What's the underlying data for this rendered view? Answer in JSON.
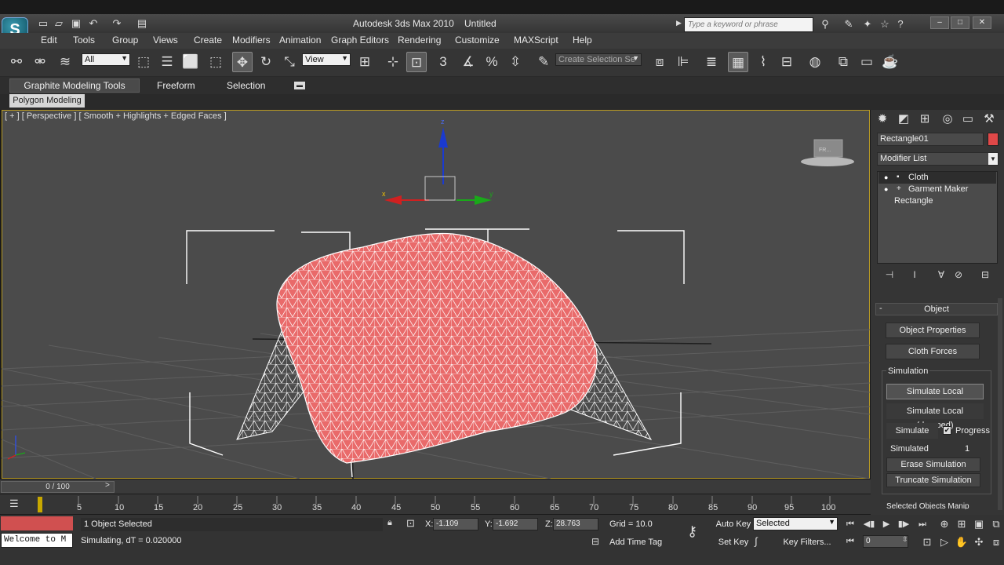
{
  "app": {
    "logo": "S",
    "title": "Autodesk 3ds Max 2010",
    "document": "Untitled",
    "search_placeholder": "Type a keyword or phrase",
    "window_buttons": [
      "–",
      "□",
      "✕"
    ]
  },
  "quick_access": [
    "new-icon",
    "open-icon",
    "save-icon",
    "undo-icon",
    "redo-icon",
    "project-icon"
  ],
  "menu": [
    "Edit",
    "Tools",
    "Group",
    "Views",
    "Create",
    "Modifiers",
    "Animation",
    "Graph Editors",
    "Rendering",
    "Customize",
    "MAXScript",
    "Help"
  ],
  "toolbar": {
    "selection_filter": "All",
    "ref_coord": "View",
    "named_selection": "Create Selection Se"
  },
  "ribbon": {
    "tabs": [
      "Graphite Modeling Tools",
      "Freeform",
      "Selection"
    ],
    "panel": "Polygon Modeling"
  },
  "viewport": {
    "label": "[ + ] [ Perspective ] [ Smooth + Highlights + Edged Faces ]",
    "gizmo_axes": {
      "x": "x",
      "y": "y",
      "z": "z"
    },
    "cloth_color": "#e96a6a",
    "viewcube_text": "FR..."
  },
  "command_panel": {
    "object_name": "Rectangle01",
    "object_color": "#e04848",
    "modifier_list": "Modifier List",
    "stack": [
      {
        "label": "Cloth",
        "active": true
      },
      {
        "label": "Garment Maker",
        "active": false
      },
      {
        "label": "Rectangle",
        "active": false
      }
    ],
    "rollout_title": "Object",
    "buttons": {
      "object_properties": "Object Properties",
      "cloth_forces": "Cloth Forces",
      "simulate_local": "Simulate Local",
      "simulate_local_damped": "Simulate Local (damped)",
      "simulate": "Simulate",
      "erase": "Erase Simulation",
      "truncate": "Truncate Simulation"
    },
    "simulation_group": "Simulation",
    "progress_label": "Progress",
    "progress_checked": true,
    "simulated_label": "Simulated",
    "simulated_value": "1",
    "next_rollout": "Selected Objects Manip"
  },
  "timeline": {
    "slider": "0 / 100",
    "ticks": [
      "5",
      "10",
      "15",
      "20",
      "25",
      "30",
      "35",
      "40",
      "45",
      "50",
      "55",
      "60",
      "65",
      "70",
      "75",
      "80",
      "85",
      "90",
      "95",
      "100"
    ]
  },
  "status": {
    "welcome": "Welcome to M",
    "selected": "1 Object Selected",
    "prompt": "Simulating, dT = 0.020000",
    "x_label": "X:",
    "x": "-1.109",
    "y_label": "Y:",
    "y": "-1.692",
    "z_label": "Z:",
    "z": "28.763",
    "grid": "Grid = 10.0",
    "add_time_tag": "Add Time Tag",
    "auto_key": "Auto Key",
    "set_key": "Set Key",
    "key_mode": "Selected",
    "key_filters": "Key Filters...",
    "frame": "0"
  }
}
